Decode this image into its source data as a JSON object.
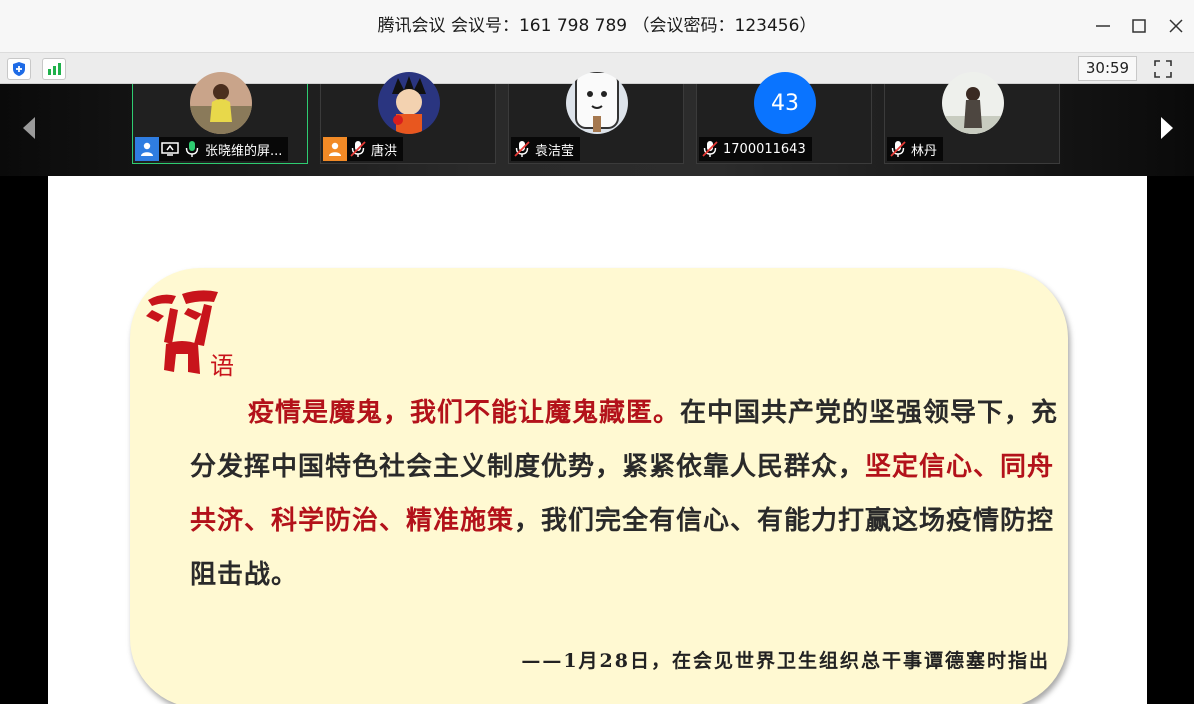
{
  "window": {
    "title": "腾讯会议 会议号：161 798 789 （会议密码：123456）",
    "minimize_icon": "minimize-icon",
    "maximize_icon": "maximize-icon",
    "close_icon": "close-icon"
  },
  "toolbar": {
    "security_icon": "shield-icon",
    "signal_icon": "signal-bars-icon",
    "timer": "30:59",
    "fullscreen_icon": "fullscreen-icon"
  },
  "participants": [
    {
      "name": "张晓维的屏...",
      "role": "host",
      "sharing": true,
      "mic": "on",
      "active": true
    },
    {
      "name": "唐洪",
      "role": "cohost",
      "mic": "muted"
    },
    {
      "name": "袁洁莹",
      "mic": "muted"
    },
    {
      "name": "1700011643",
      "avatar_text": "43",
      "mic": "muted"
    },
    {
      "name": "林丹",
      "mic": "muted"
    }
  ],
  "slide": {
    "logo_char": "习",
    "logo_suffix": "语",
    "red1": "疫情是魔鬼，我们不能让魔鬼藏匿。",
    "black1": "在中国共产党的坚强领导下，充分发挥中国特色社会主义制度优势，紧紧依靠人民群众，",
    "red2": "坚定信心、同舟共济、科学防治、精准施策",
    "black2": "，我们完全有信心、有能力打赢这场疫情防控阻击战。",
    "source": "——1月28日，在会见世界卫生组织总干事谭德塞时指出"
  },
  "colors": {
    "accent_blue": "#0a74ff",
    "slide_red": "#b3121a",
    "card_bg": "#fff9d2",
    "signal_green": "#1fb14b"
  }
}
